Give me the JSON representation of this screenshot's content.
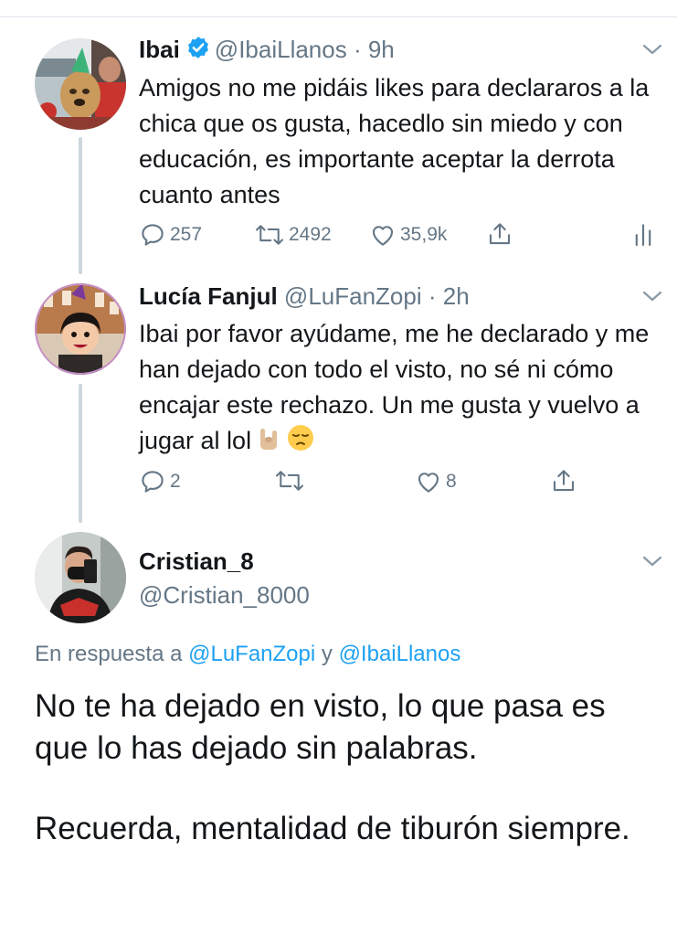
{
  "thread": [
    {
      "name": "Ibai",
      "verified": true,
      "handle": "@IbaiLlanos",
      "time": "· 9h",
      "text": "Amigos no me pidáis likes para declararos a la chica que os gusta, hacedlo sin miedo y con educación, es importante aceptar la derrota cuanto antes",
      "replies": "257",
      "retweets": "2492",
      "likes": "35,9k"
    },
    {
      "name": "Lucía Fanjul",
      "verified": false,
      "handle": "@LuFanZopi",
      "time": "· 2h",
      "text": "Ibai por favor ayúdame, me he declarado y me han dejado con todo el visto, no sé ni cómo encajar este rechazo. Un me gusta y vuelvo a jugar al lol",
      "replies": "2",
      "retweets": "",
      "likes": "8"
    }
  ],
  "main_tweet": {
    "name": "Cristian_8",
    "handle": "@Cristian_8000",
    "reply_prefix": "En respuesta a",
    "reply_mention_1": "@LuFanZopi",
    "reply_joiner": "y",
    "reply_mention_2": "@IbaiLlanos",
    "paragraph_1": "No te ha dejado en visto, lo que pasa es que lo has dejado sin palabras.",
    "paragraph_2": "Recuerda, mentalidad de tiburón siempre."
  },
  "icons": {
    "reply": "reply-bubble-icon",
    "retweet": "retweet-icon",
    "like": "heart-icon",
    "share": "share-icon",
    "analytics": "analytics-icon",
    "menu": "chevron-down-icon",
    "verified": "verified-badge-icon"
  },
  "colors": {
    "text": "#14171a",
    "secondary": "#657786",
    "link": "#1da1f2",
    "thread_line": "#ccd6dd",
    "verified": "#1da1f2"
  }
}
